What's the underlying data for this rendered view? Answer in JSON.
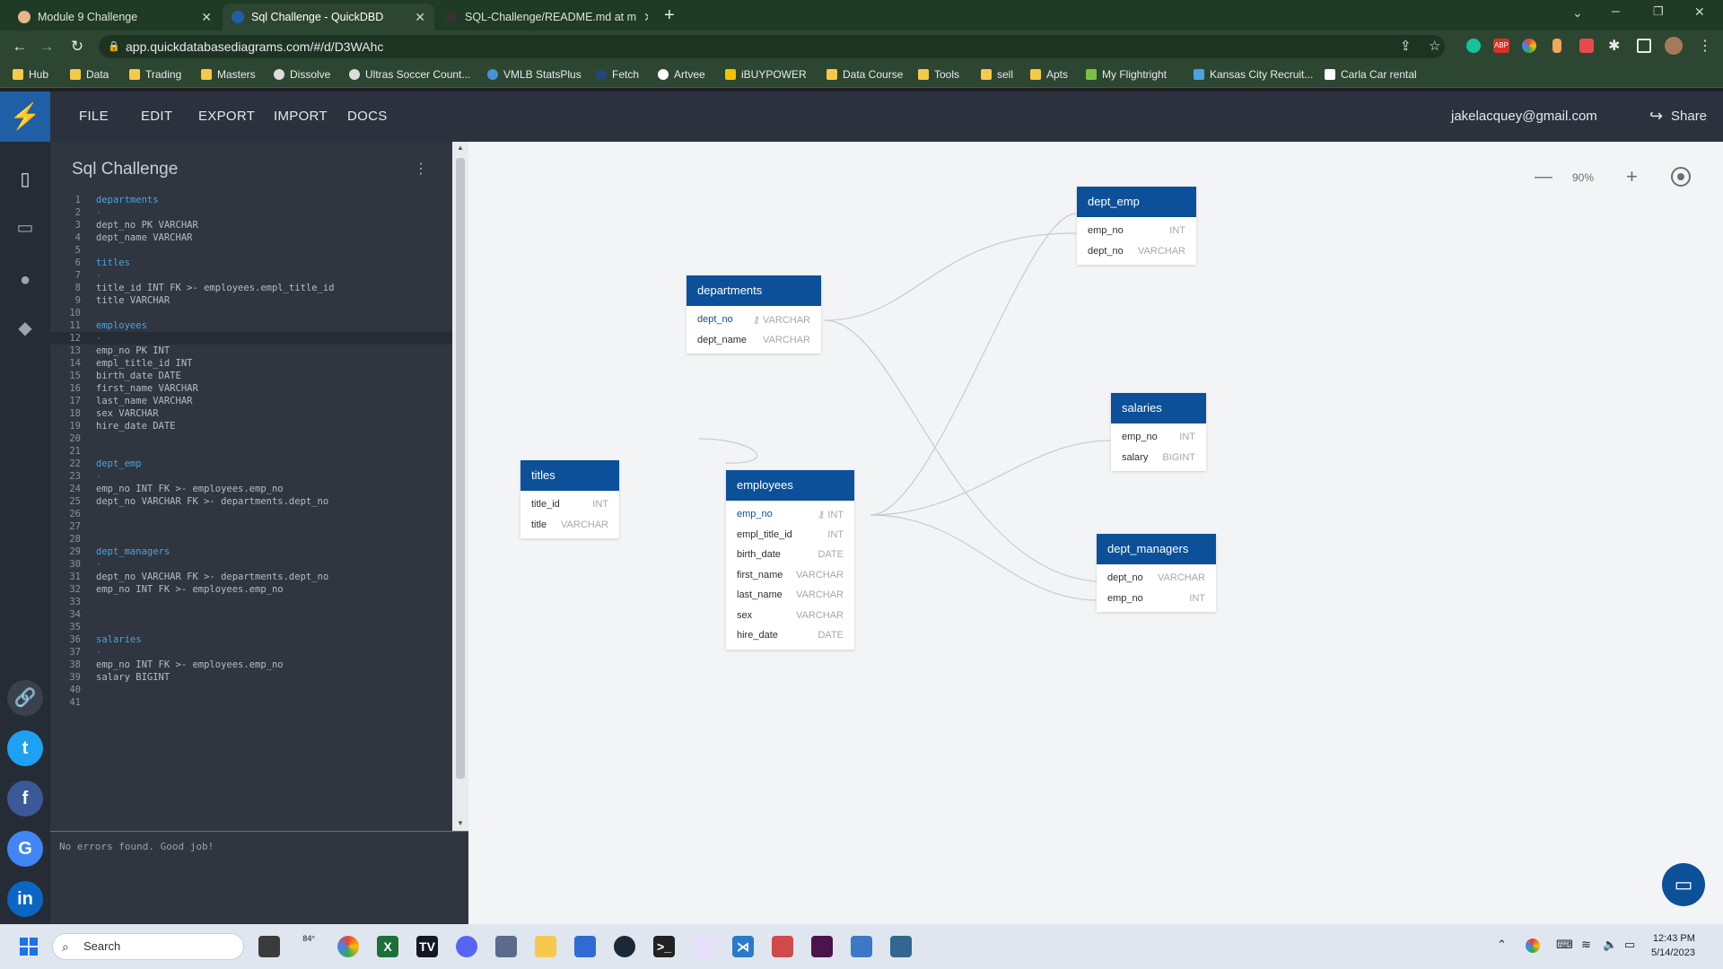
{
  "browser": {
    "tabs": [
      {
        "label": "Module 9 Challenge",
        "active": false
      },
      {
        "label": "Sql Challenge - QuickDBD",
        "active": true
      },
      {
        "label": "SQL-Challenge/README.md at m",
        "active": false
      }
    ],
    "url": "app.quickdatabasediagrams.com/#/d/D3WAhc",
    "bookmarks": [
      "Hub",
      "Data",
      "Trading",
      "Masters",
      "Dissolve",
      "Ultras Soccer Count...",
      "VMLB StatsPlus",
      "Fetch",
      "Artvee",
      "iBUYPOWER",
      "Data Course",
      "Tools",
      "sell",
      "Apts",
      "My Flightright",
      "Kansas City Recruit...",
      "Carla Car rental"
    ]
  },
  "app": {
    "menu": [
      "FILE",
      "EDIT",
      "EXPORT",
      "IMPORT",
      "DOCS"
    ],
    "user_email": "jakelacquey@gmail.com",
    "share_label": "Share",
    "doc_title": "Sql Challenge",
    "console_message": "No errors found. Good job!",
    "zoom": "90%"
  },
  "code_lines": [
    {
      "n": "1",
      "t": "departments",
      "k": "tbl"
    },
    {
      "n": "2",
      "t": "-",
      "k": "dash"
    },
    {
      "n": "3",
      "t": "dept_no PK VARCHAR",
      "k": ""
    },
    {
      "n": "4",
      "t": "dept_name VARCHAR",
      "k": ""
    },
    {
      "n": "5",
      "t": "",
      "k": ""
    },
    {
      "n": "6",
      "t": "titles",
      "k": "tbl"
    },
    {
      "n": "7",
      "t": "-",
      "k": "dash"
    },
    {
      "n": "8",
      "t": "title_id INT FK >- employees.empl_title_id",
      "k": ""
    },
    {
      "n": "9",
      "t": "title VARCHAR",
      "k": ""
    },
    {
      "n": "10",
      "t": "",
      "k": ""
    },
    {
      "n": "11",
      "t": "employees",
      "k": "tbl"
    },
    {
      "n": "12",
      "t": "-",
      "k": "dash"
    },
    {
      "n": "13",
      "t": "emp_no PK INT",
      "k": ""
    },
    {
      "n": "14",
      "t": "empl_title_id INT",
      "k": ""
    },
    {
      "n": "15",
      "t": "birth_date DATE",
      "k": ""
    },
    {
      "n": "16",
      "t": "first_name VARCHAR",
      "k": ""
    },
    {
      "n": "17",
      "t": "last_name VARCHAR",
      "k": ""
    },
    {
      "n": "18",
      "t": "sex VARCHAR",
      "k": ""
    },
    {
      "n": "19",
      "t": "hire_date DATE",
      "k": ""
    },
    {
      "n": "20",
      "t": "",
      "k": ""
    },
    {
      "n": "21",
      "t": "",
      "k": ""
    },
    {
      "n": "22",
      "t": "dept_emp",
      "k": "tbl"
    },
    {
      "n": "23",
      "t": "-",
      "k": "dash"
    },
    {
      "n": "24",
      "t": "emp_no INT FK >- employees.emp_no",
      "k": ""
    },
    {
      "n": "25",
      "t": "dept_no VARCHAR FK >- departments.dept_no",
      "k": ""
    },
    {
      "n": "26",
      "t": "",
      "k": ""
    },
    {
      "n": "27",
      "t": "",
      "k": ""
    },
    {
      "n": "28",
      "t": "",
      "k": ""
    },
    {
      "n": "29",
      "t": "dept_managers",
      "k": "tbl"
    },
    {
      "n": "30",
      "t": "-",
      "k": "dash"
    },
    {
      "n": "31",
      "t": "dept_no VARCHAR FK >- departments.dept_no",
      "k": ""
    },
    {
      "n": "32",
      "t": "emp_no INT FK >- employees.emp_no",
      "k": ""
    },
    {
      "n": "33",
      "t": "",
      "k": ""
    },
    {
      "n": "34",
      "t": "",
      "k": ""
    },
    {
      "n": "35",
      "t": "",
      "k": ""
    },
    {
      "n": "36",
      "t": "salaries",
      "k": "tbl"
    },
    {
      "n": "37",
      "t": "-",
      "k": "dash"
    },
    {
      "n": "38",
      "t": "emp_no INT FK >- employees.emp_no",
      "k": ""
    },
    {
      "n": "39",
      "t": "salary BIGINT",
      "k": ""
    },
    {
      "n": "40",
      "t": "",
      "k": ""
    },
    {
      "n": "41",
      "t": "",
      "k": ""
    }
  ],
  "tables": {
    "departments": {
      "name": "departments",
      "fields": [
        {
          "n": "dept_no",
          "t": "VARCHAR"
        },
        {
          "n": "dept_name",
          "t": "VARCHAR"
        }
      ]
    },
    "titles": {
      "name": "titles",
      "fields": [
        {
          "n": "title_id",
          "t": "INT"
        },
        {
          "n": "title",
          "t": "VARCHAR"
        }
      ]
    },
    "employees": {
      "name": "employees",
      "fields": [
        {
          "n": "emp_no",
          "t": "INT"
        },
        {
          "n": "empl_title_id",
          "t": "INT"
        },
        {
          "n": "birth_date",
          "t": "DATE"
        },
        {
          "n": "first_name",
          "t": "VARCHAR"
        },
        {
          "n": "last_name",
          "t": "VARCHAR"
        },
        {
          "n": "sex",
          "t": "VARCHAR"
        },
        {
          "n": "hire_date",
          "t": "DATE"
        }
      ]
    },
    "dept_emp": {
      "name": "dept_emp",
      "fields": [
        {
          "n": "emp_no",
          "t": "INT"
        },
        {
          "n": "dept_no",
          "t": "VARCHAR"
        }
      ]
    },
    "salaries": {
      "name": "salaries",
      "fields": [
        {
          "n": "emp_no",
          "t": "INT"
        },
        {
          "n": "salary",
          "t": "BIGINT"
        }
      ]
    },
    "dept_managers": {
      "name": "dept_managers",
      "fields": [
        {
          "n": "dept_no",
          "t": "VARCHAR"
        },
        {
          "n": "emp_no",
          "t": "INT"
        }
      ]
    }
  },
  "taskbar": {
    "search_label": "Search",
    "weather": "84°",
    "time": "12:43 PM",
    "date": "5/14/2023"
  }
}
